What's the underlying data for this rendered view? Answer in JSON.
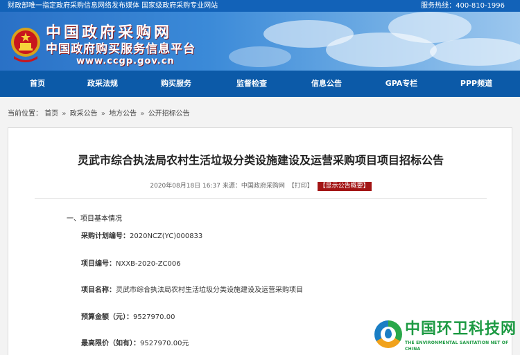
{
  "topbar": {
    "notice": "财政部唯一指定政府采购信息网络发布媒体 国家级政府采购专业网站",
    "hotline": "服务热线：400-810-1996"
  },
  "header": {
    "title": "中国政府采购网",
    "subtitle": "中国政府购买服务信息平台",
    "url": "www.ccgp.gov.cn"
  },
  "nav": {
    "items": [
      {
        "label": "首页"
      },
      {
        "label": "政采法规"
      },
      {
        "label": "购买服务"
      },
      {
        "label": "监督检查"
      },
      {
        "label": "信息公告"
      },
      {
        "label": "GPA专栏"
      },
      {
        "label": "PPP频道"
      }
    ]
  },
  "breadcrumb": {
    "prefix": "当前位置：",
    "items": [
      "首页",
      "政采公告",
      "地方公告",
      "公开招标公告"
    ],
    "separator": "»"
  },
  "article": {
    "title": "灵武市综合执法局农村生活垃圾分类设施建设及运营采购项目项目招标公告",
    "meta": "2020年08月18日 16:37 来源：中国政府采购网",
    "print_label": "【打印】",
    "summary_button": "【显示公告概要】",
    "section_title": "一、项目基本情况",
    "fields": [
      {
        "key": "采购计划编号：",
        "value": "2020NCZ(YC)000833"
      },
      {
        "key": "项目编号：",
        "value": "NXXB-2020-ZC006"
      },
      {
        "key": "项目名称：",
        "value": "灵武市综合执法局农村生活垃圾分类设施建设及运营采购项目"
      },
      {
        "key": "预算金额（元）：",
        "value": "9527970.00"
      },
      {
        "key": "最高限价（如有）：",
        "value": "9527970.00元"
      }
    ]
  },
  "watermark": {
    "name": "中国环卫科技网",
    "english": "THE ENVIRONMENTAL SANITATION NET OF CHINA"
  },
  "colors": {
    "topbar": "#1262b8",
    "nav": "#0c5aa8",
    "accent_red": "#a31515",
    "watermark_green": "#1d9a43"
  }
}
